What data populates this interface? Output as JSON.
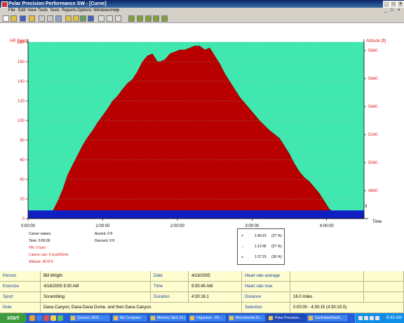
{
  "window": {
    "title": "Polar Precision Performance SW - [Curve]",
    "controls": [
      "_",
      "□",
      "×"
    ]
  },
  "menu": {
    "items": [
      "File",
      "Edit",
      "View",
      "Tools",
      "Tests",
      "Reports",
      "Options",
      "Windows",
      "Help"
    ],
    "mdi_controls": [
      "_",
      "□",
      "×"
    ]
  },
  "toolbar": {
    "icons": [
      "new-icon",
      "open-icon",
      "save-icon",
      "folder-icon",
      "print-icon",
      "globe-icon",
      "window-icon",
      "folder2-icon",
      "image-icon",
      "calendar-icon",
      "chart-icon",
      "zoom-icon",
      "tile-icon",
      "pointer-icon",
      "run1-icon",
      "run2-icon",
      "run3-icon",
      "run4-icon",
      "run5-icon"
    ]
  },
  "chart_data": {
    "type": "area",
    "left_axis": {
      "label": "HR [bpm]",
      "ticks": [
        0,
        20,
        40,
        60,
        80,
        100,
        120,
        140,
        160,
        180
      ],
      "ylim": [
        0,
        180
      ]
    },
    "right_axis": {
      "label": "Altitude [ft]",
      "ticks": [
        4840,
        5040,
        5240,
        5440,
        5640,
        5840
      ]
    },
    "x_axis": {
      "label": "Time",
      "ticks": [
        "0:00:00",
        "1:00:00",
        "2:00:00",
        "3:00:00",
        "4:00:00"
      ],
      "end_label": "3"
    },
    "colors": {
      "background": "#40e8b0",
      "fill": "#b80000",
      "hr_line": "#1020d8",
      "hr_area": "#1020c0",
      "grid": "#88aa99"
    },
    "series": [
      {
        "name": "Altitude",
        "x_minutes": [
          0,
          4,
          8,
          12,
          16,
          20,
          24,
          28,
          32,
          36,
          40,
          44,
          48,
          52,
          56,
          60,
          64,
          68,
          72,
          76,
          80,
          84,
          88,
          92,
          96,
          100,
          104,
          106,
          110,
          114,
          118,
          122,
          126,
          130,
          134,
          138,
          142,
          146,
          150,
          154,
          158,
          162,
          166,
          170,
          174,
          178,
          182,
          186,
          190,
          194,
          198,
          202,
          206,
          210,
          214,
          218,
          222,
          226,
          230,
          234,
          238,
          242,
          246,
          250,
          254,
          258,
          262,
          266,
          270
        ],
        "values_hr_scale": [
          2,
          7,
          3,
          6,
          5,
          8,
          18,
          30,
          45,
          55,
          65,
          75,
          83,
          90,
          98,
          105,
          112,
          120,
          125,
          132,
          138,
          142,
          150,
          160,
          166,
          168,
          160,
          160,
          162,
          168,
          170,
          172,
          172,
          174,
          176,
          176,
          172,
          174,
          166,
          158,
          148,
          140,
          132,
          124,
          118,
          112,
          106,
          100,
          95,
          90,
          86,
          82,
          74,
          66,
          56,
          48,
          42,
          38,
          32,
          26,
          18,
          10,
          6,
          8,
          6,
          5,
          4,
          4,
          4
        ]
      }
    ],
    "hr_line_value": 8
  },
  "cursor_info": {
    "title": "Cursor values:",
    "time": "Time: 0:00:00",
    "hr": "HR: 0 bpm",
    "calorie_rate": "Calorie rate: 0 kcal/60min",
    "altitude": "Altitude: 4678 ft",
    "ascent": "Ascent: 0 ft",
    "descent": "Descent: 0 ft"
  },
  "legend": {
    "rows": [
      {
        "time": "1:40:15",
        "pct": "(37 %)"
      },
      {
        "time": "1:12:45",
        "pct": "(27 %)"
      },
      {
        "time": "1:37:15",
        "pct": "(36 %)"
      }
    ]
  },
  "info": {
    "person_label": "Person",
    "person": "Bill Wright",
    "date_label": "Date",
    "date": "4/16/2005",
    "hr_avg_label": "Heart rate average",
    "hr_avg": "",
    "exercise_label": "Exercise",
    "exercise": "4/16/2005 9:30 AM",
    "time_label": "Time",
    "time": "9:30:45 AM",
    "hr_max_label": "Heart rate max",
    "hr_max": "",
    "sport_label": "Sport",
    "sport": "Scrambling",
    "duration_label": "Duration",
    "duration": "4:30:16.1",
    "distance_label": "Distance",
    "distance": "16.0 miles",
    "note_label": "Note",
    "note": "Dana Canyon, Dana Dana Dome, and then Dana Canyon.",
    "selection_label": "Selection",
    "selection": "0:00:00 - 4:30:15 (4:30:15.0)"
  },
  "taskbar": {
    "start": "start",
    "tasks": [
      "Quicken 2005 ...",
      "My Computer",
      "Memory Stick (G:)",
      "Organizer - Ph...",
      "Macromedia Dr...",
      "Polar Precision...",
      "SanRafaelSwell..."
    ],
    "active_index": 5,
    "clock": "8:43 AM"
  }
}
